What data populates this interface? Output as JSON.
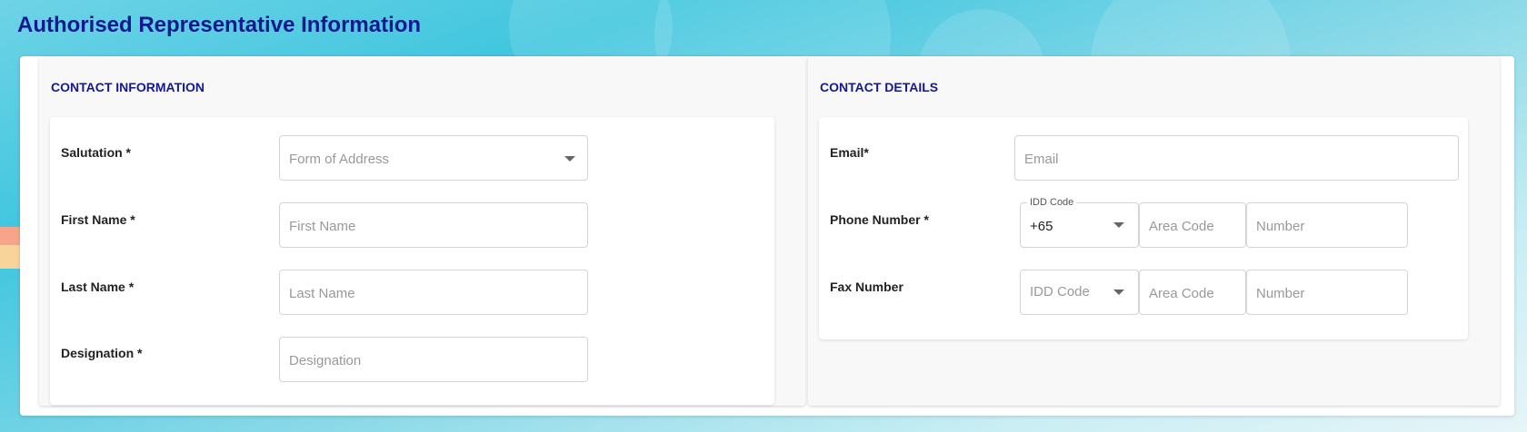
{
  "page_title": "Authorised Representative Information",
  "contact_information": {
    "section_title": "CONTACT INFORMATION",
    "salutation": {
      "label": "Salutation *",
      "placeholder": "Form of Address"
    },
    "first_name": {
      "label": "First Name *",
      "placeholder": "First Name"
    },
    "last_name": {
      "label": "Last Name *",
      "placeholder": "Last Name"
    },
    "designation": {
      "label": "Designation *",
      "placeholder": "Designation"
    }
  },
  "contact_details": {
    "section_title": "CONTACT DETAILS",
    "email": {
      "label": "Email*",
      "placeholder": "Email"
    },
    "phone": {
      "label": "Phone Number *",
      "idd_legend": "IDD Code",
      "idd_value": "+65",
      "area_placeholder": "Area Code",
      "number_placeholder": "Number"
    },
    "fax": {
      "label": "Fax Number",
      "idd_placeholder": "IDD Code",
      "area_placeholder": "Area Code",
      "number_placeholder": "Number"
    }
  },
  "colors": {
    "title": "#15198f",
    "panel_bg": "#f8f8f8",
    "field_border": "#d4d4d4",
    "placeholder": "#999999"
  }
}
